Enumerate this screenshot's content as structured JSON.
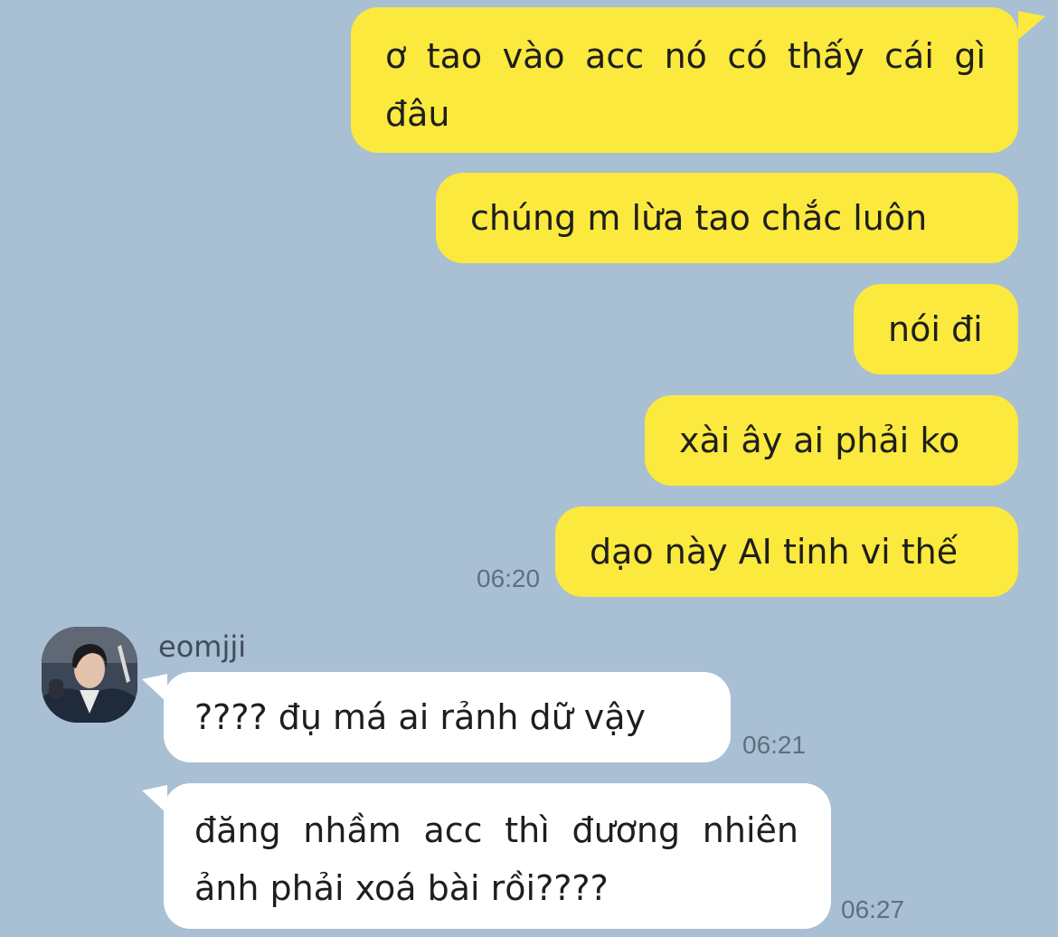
{
  "theme": {
    "background": "#a9bfd3",
    "outgoing_bubble": "#fbe93d",
    "incoming_bubble": "#ffffff",
    "timestamp_color": "#5f6f80"
  },
  "outgoing_messages": [
    {
      "text": "ơ tao vào acc nó có thấy cái gì đâu"
    },
    {
      "text": "chúng m lừa tao chắc luôn"
    },
    {
      "text": "nói đi"
    },
    {
      "text": "xài ây ai phải ko"
    },
    {
      "text": "dạo này AI tinh vi thế",
      "time": "06:20"
    }
  ],
  "contact": {
    "name": "eomjji",
    "avatar_icon": "profile-photo"
  },
  "incoming_messages": [
    {
      "text": "???? đụ má ai rảnh dữ vậy",
      "time": "06:21"
    },
    {
      "text": "đăng nhầm acc thì đương nhiên ảnh phải xoá bài rồi????",
      "time": "06:27"
    }
  ]
}
